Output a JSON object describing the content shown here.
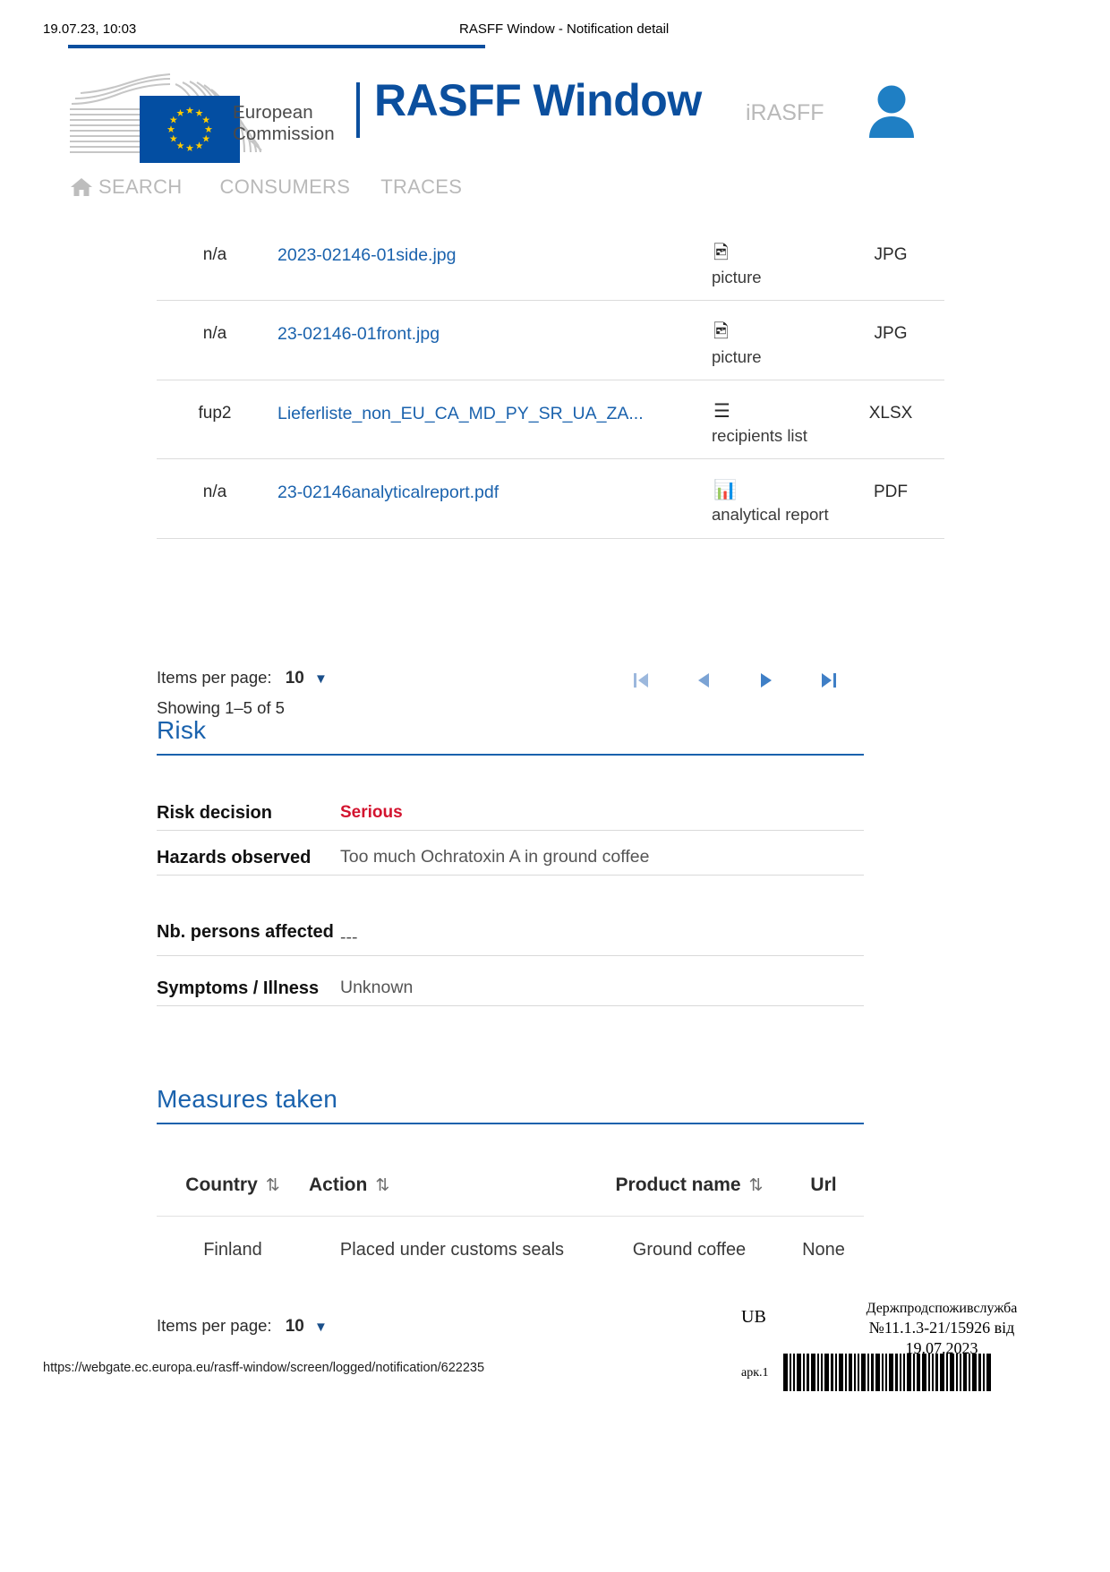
{
  "print_header": {
    "date": "19.07.23, 10:03",
    "document_title": "RASFF Window - Notification detail"
  },
  "brand": {
    "org_line1": "European",
    "org_line2": "Commission",
    "app_title": "RASFF Window",
    "app_subtitle": "iRASFF",
    "user_icon": "user-avatar-icon",
    "primary_color": "#0b4f9e",
    "flag_color": "#034ea2",
    "star_color": "#ffcc00"
  },
  "nav": {
    "items": [
      {
        "label": "SEARCH",
        "icon": "home-icon"
      },
      {
        "label": "CONSUMERS",
        "icon": ""
      },
      {
        "label": "TRACES",
        "icon": ""
      }
    ]
  },
  "attachments": {
    "rows": [
      {
        "ref": "n/a",
        "filename": "2023-02146-01side.jpg",
        "type": "picture",
        "type_icon": "image-icon",
        "ext": "JPG"
      },
      {
        "ref": "n/a",
        "filename": "23-02146-01front.jpg",
        "type": "picture",
        "type_icon": "image-icon",
        "ext": "JPG"
      },
      {
        "ref": "fup2",
        "filename": "Lieferliste_non_EU_CA_MD_PY_SR_UA_ZA...",
        "type": "recipients list",
        "type_icon": "list-icon",
        "ext": "XLSX"
      },
      {
        "ref": "n/a",
        "filename": "23-02146analyticalreport.pdf",
        "type": "analytical report",
        "type_icon": "bar-chart-icon",
        "ext": "PDF"
      }
    ],
    "pager": {
      "items_per_page_label": "Items per page:",
      "items_per_page_value": "10",
      "showing": "Showing 1–5 of 5",
      "first_icon": "first-page-icon",
      "prev_icon": "previous-page-icon",
      "next_icon": "next-page-icon",
      "last_icon": "last-page-icon"
    }
  },
  "risk": {
    "title": "Risk",
    "rows": [
      {
        "label": "Risk decision",
        "value": "Serious",
        "highlight": true
      },
      {
        "label": "Hazards observed",
        "value": "Too much Ochratoxin A in ground coffee",
        "highlight": false
      },
      {
        "label": "Nb. persons affected",
        "value": "---",
        "highlight": false
      },
      {
        "label": "Symptoms / Illness",
        "value": "Unknown",
        "highlight": false
      }
    ],
    "serious_color": "#d3142f"
  },
  "measures": {
    "title": "Measures taken",
    "columns": [
      {
        "label": "Country",
        "sortable": true
      },
      {
        "label": "Action",
        "sortable": true
      },
      {
        "label": "Product name",
        "sortable": true
      },
      {
        "label": "Url",
        "sortable": false
      }
    ],
    "rows": [
      {
        "country": "Finland",
        "action": "Placed under customs seals",
        "product": "Ground coffee",
        "url": "None"
      }
    ],
    "pager": {
      "items_per_page_label": "Items per page:",
      "items_per_page_value": "10"
    }
  },
  "stamp": {
    "ub": "UB",
    "organisation": "Держпродспоживслужба",
    "number": "№11.1.3-21/15926 від",
    "date": "19.07.2023",
    "sheet": "арк.1"
  },
  "footer": {
    "url": "https://webgate.ec.europa.eu/rasff-window/screen/logged/notification/622235"
  }
}
